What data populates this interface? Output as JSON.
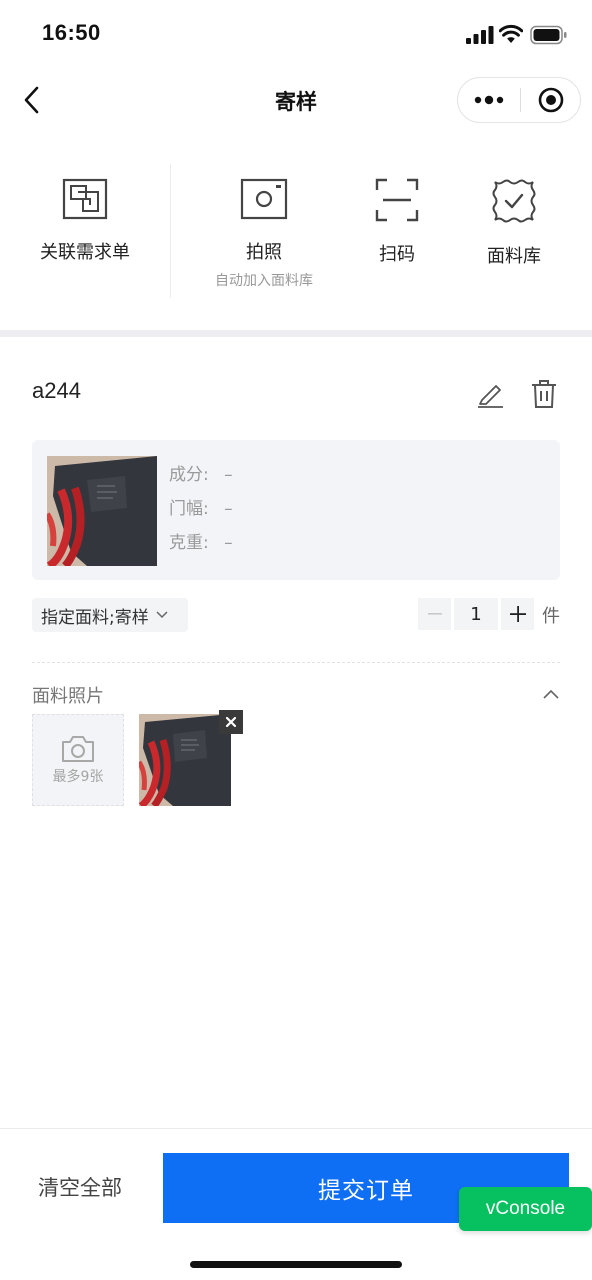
{
  "status_bar": {
    "time": "16:50"
  },
  "nav": {
    "title": "寄样"
  },
  "actions": [
    {
      "label": "关联需求单",
      "icon": "link-doc-icon"
    },
    {
      "label": "拍照",
      "sublabel": "自动加入面料库",
      "icon": "camera-icon"
    },
    {
      "label": "扫码",
      "icon": "scan-icon"
    },
    {
      "label": "面料库",
      "icon": "fabric-library-icon"
    }
  ],
  "item": {
    "name": "a244",
    "specs": [
      {
        "label": "成分:",
        "value": "–"
      },
      {
        "label": "门幅:",
        "value": "–"
      },
      {
        "label": "克重:",
        "value": "–"
      }
    ],
    "sample_type": "指定面料;寄样",
    "quantity": "1",
    "unit": "件"
  },
  "photos": {
    "title": "面料照片",
    "upload_label": "最多9张",
    "count": 1
  },
  "footer": {
    "clear_label": "清空全部",
    "submit_label": "提交订单",
    "vconsole_label": "vConsole"
  },
  "colors": {
    "primary": "#0f6ff4",
    "vconsole": "#07c160",
    "card_bg": "#f3f4f8"
  }
}
